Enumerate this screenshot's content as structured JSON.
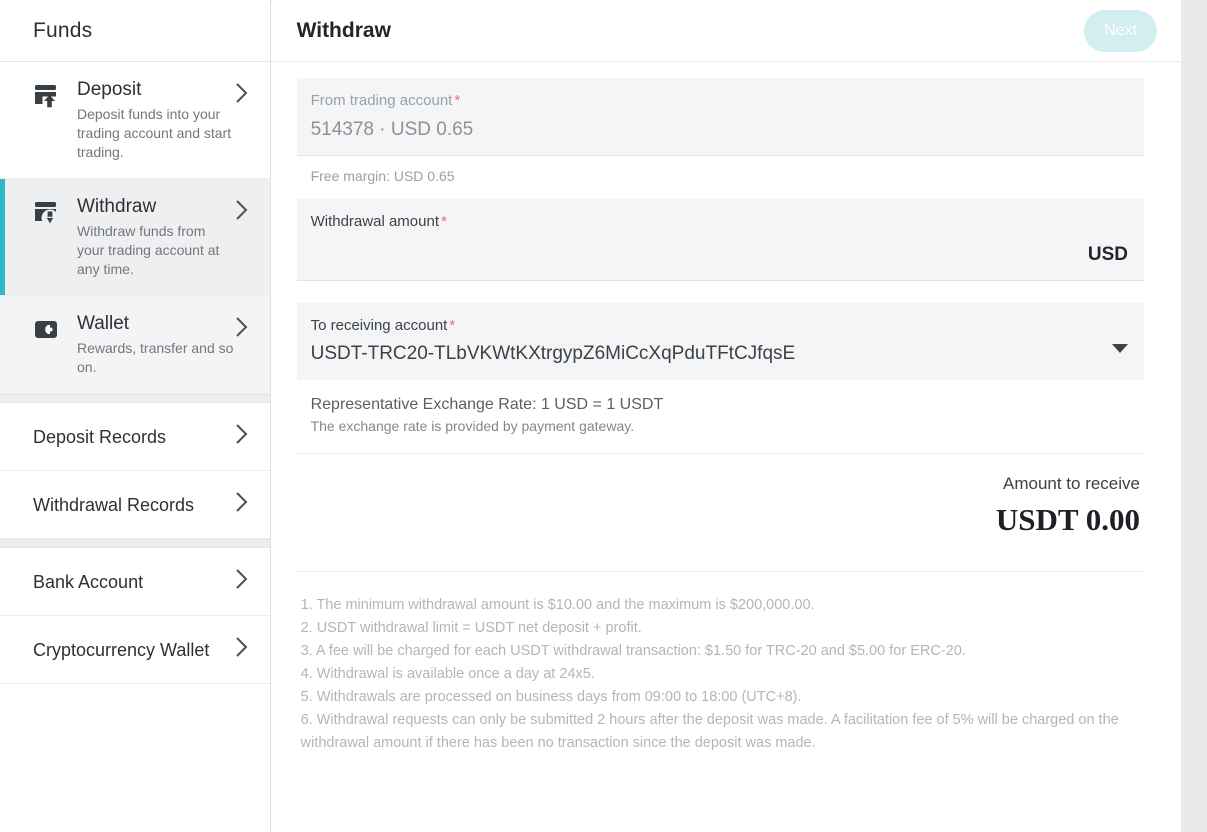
{
  "sidebar": {
    "title": "Funds",
    "primary_items": [
      {
        "icon": "deposit-card-up-arrow-icon",
        "label": "Deposit",
        "desc": "Deposit funds into your trading account and start trading.",
        "chevron": "chevron-right-icon"
      },
      {
        "icon": "withdraw-card-down-arrow-icon",
        "label": "Withdraw",
        "desc": "Withdraw funds from your trading account at any time.",
        "chevron": "chevron-right-icon"
      },
      {
        "icon": "wallet-icon",
        "label": "Wallet",
        "desc": "Rewards, transfer and so on.",
        "chevron": "chevron-right-icon"
      }
    ],
    "records_items": [
      {
        "label": "Deposit Records",
        "chevron": "chevron-right-icon"
      },
      {
        "label": "Withdrawal Records",
        "chevron": "chevron-right-icon"
      }
    ],
    "account_items": [
      {
        "label": "Bank Account",
        "chevron": "chevron-right-icon"
      },
      {
        "label": "Cryptocurrency Wallet",
        "chevron": "chevron-right-icon"
      }
    ],
    "active_index": 1,
    "accent_color": "#2fb9c6"
  },
  "header": {
    "title": "Withdraw",
    "next_label": "Next",
    "next_bg": "#d3eef1"
  },
  "form": {
    "from_account": {
      "label": "From trading account",
      "required_mark": "*",
      "value": "514378 · USD 0.65",
      "hint": "Free margin: USD 0.65"
    },
    "amount": {
      "label": "Withdrawal amount",
      "required_mark": "*",
      "value": "",
      "placeholder": "",
      "unit": "USD"
    },
    "to_account": {
      "label": "To receiving account",
      "required_mark": "*",
      "value": "USDT-TRC20-TLbVKWtKXtrgypZ6MiCcXqPduTFtCJfqsE",
      "caret": "chevron-down-icon"
    },
    "rate": {
      "line": "Representative Exchange Rate: 1 USD = 1 USDT",
      "sub": "The exchange rate is provided by payment gateway."
    },
    "receive": {
      "label": "Amount to receive",
      "value": "USDT 0.00"
    }
  },
  "terms": [
    "1. The minimum withdrawal amount is $10.00 and the maximum is $200,000.00.",
    "2. USDT withdrawal limit = USDT net deposit + profit.",
    "3. A fee will be charged for each USDT withdrawal transaction: $1.50 for TRC-20 and $5.00 for ERC-20.",
    "4. Withdrawal is available once a day at 24x5.",
    "5. Withdrawals are processed on business days from 09:00 to 18:00 (UTC+8).",
    "6. Withdrawal requests can only be submitted 2 hours after the deposit was made. A facilitation fee of 5% will be charged on the withdrawal amount if there has been no transaction since the deposit was made."
  ]
}
